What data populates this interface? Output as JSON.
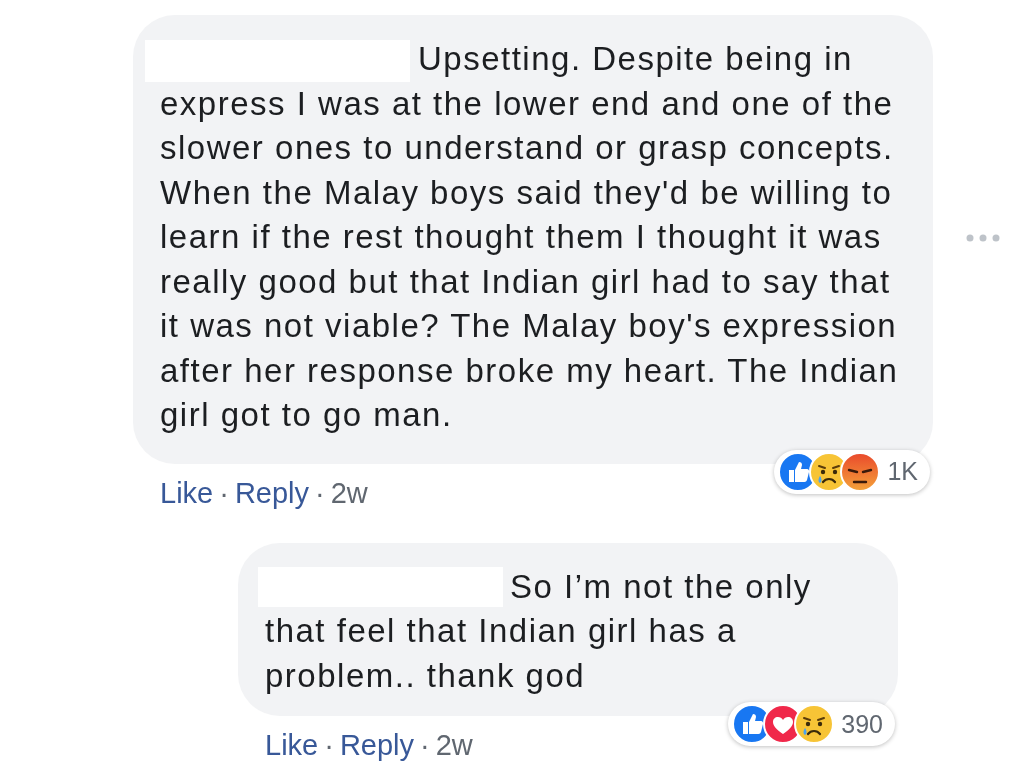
{
  "comments": [
    {
      "text": "Upsetting. Despite being in express I was at the lower end and one of the slower ones to understand or grasp concepts. When the Malay boys said they'd be willing to learn if the rest thought them I thought it was really good but that Indian girl had to say that it was not viable? The Malay boy's expression after her response broke my heart. The Indian girl got to go man.",
      "reactions": [
        {
          "kind": "like"
        },
        {
          "kind": "sad"
        },
        {
          "kind": "angry"
        }
      ],
      "reaction_count": "1K",
      "actions": [
        "Like",
        "Reply"
      ],
      "separator": "·",
      "time": "2w",
      "replies": [
        {
          "text": "So I’m not the only that feel that Indian girl has a problem.. thank god",
          "reactions": [
            {
              "kind": "like"
            },
            {
              "kind": "love"
            },
            {
              "kind": "sad"
            }
          ],
          "reaction_count": "390",
          "actions": [
            "Like",
            "Reply"
          ],
          "separator": "·",
          "time": "2w"
        }
      ]
    }
  ]
}
